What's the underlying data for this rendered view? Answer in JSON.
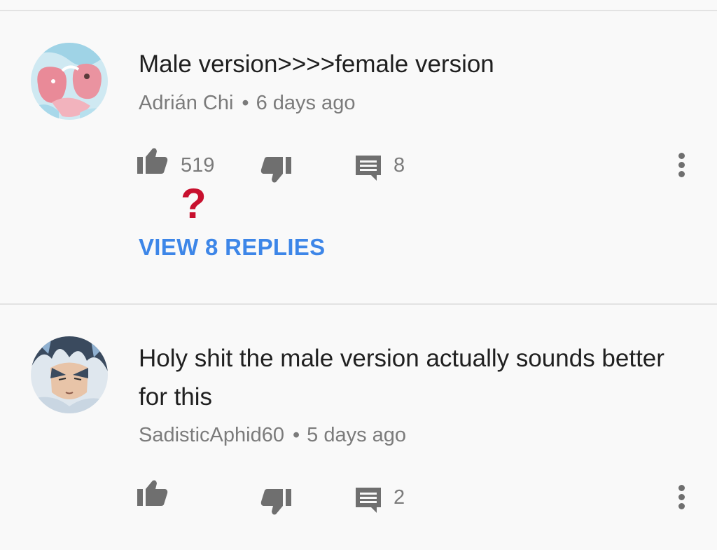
{
  "comments": [
    {
      "text": "Male version>>>>female version",
      "author": "Adrián Chi",
      "separator": "•",
      "time": "6 days ago",
      "likes": "519",
      "replies_count": "8",
      "view_replies_label": "VIEW 8 REPLIES",
      "avatar_icon": "pink-cartoon-avatar-icon"
    },
    {
      "text": "Holy shit the male version actually sounds better for this",
      "author": "SadisticAphid60",
      "separator": "•",
      "time": "5 days ago",
      "likes": "",
      "replies_count": "2",
      "avatar_icon": "anime-character-avatar-icon"
    }
  ],
  "annotation": {
    "text": "?",
    "color": "#c8102e"
  },
  "colors": {
    "link": "#3d86e8",
    "text": "#202020",
    "secondary": "#7b7b7b",
    "icon": "#6f6f6f"
  },
  "icons": {
    "like": "thumbs-up-icon",
    "dislike": "thumbs-down-icon",
    "reply": "comment-icon",
    "more": "more-vertical-icon"
  }
}
